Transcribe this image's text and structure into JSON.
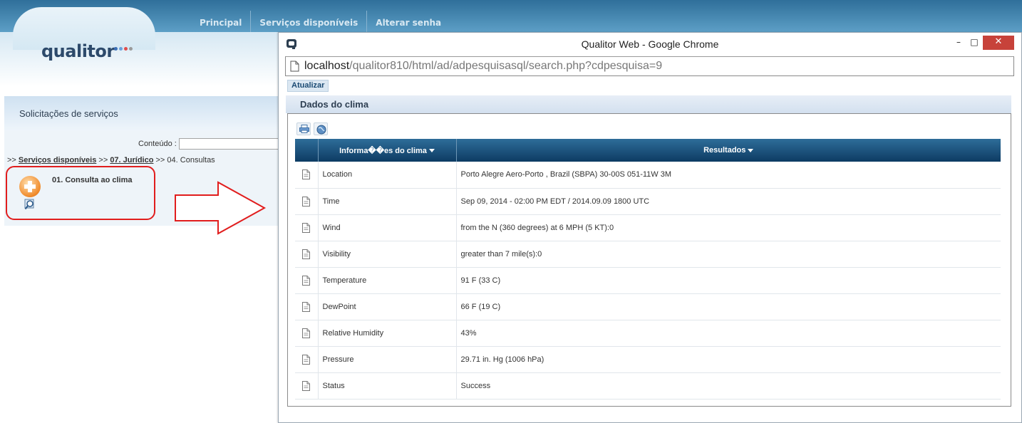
{
  "app": {
    "logo_text": "qualitor",
    "logo_dot_colors": [
      "#3a6fb7",
      "#6aa1dc",
      "#e14b4b",
      "#9a9a9a",
      "#6aa1dc"
    ],
    "nav": [
      "Principal",
      "Serviços disponíveis",
      "Alterar senha"
    ],
    "panel_title": "Solicitações de serviços",
    "search_label": "Conteúdo :",
    "search_value": "",
    "breadcrumb": {
      "prefix": ">> ",
      "link1": "Serviços disponíveis",
      "sep1": " >> ",
      "link2": "07. Jurídico",
      "sep2": " >> ",
      "current": "04. Consultas"
    },
    "service_item_label": "01. Consulta ao clima"
  },
  "popup": {
    "window_title": "Qualitor Web - Google Chrome",
    "controls": {
      "minimize": "–",
      "maximize": "□",
      "close": "✕"
    },
    "url_host": "localhost",
    "url_path": "/qualitor810/html/ad/adpesquisasql/search.php?cdpesquisa=9",
    "refresh_label": "Atualizar",
    "section_title": "Dados do clima",
    "toolbar_icons": [
      "print-icon",
      "globe-icon"
    ],
    "table": {
      "headers": [
        "",
        "Informa��es do clima",
        "Resultados"
      ],
      "rows": [
        {
          "key": "Location",
          "value": "Porto Alegre Aero-Porto , Brazil (SBPA) 30-00S 051-11W 3M"
        },
        {
          "key": "Time",
          "value": "Sep 09, 2014 - 02:00 PM EDT / 2014.09.09 1800 UTC"
        },
        {
          "key": "Wind",
          "value": "from the N (360 degrees) at 6 MPH (5 KT):0"
        },
        {
          "key": "Visibility",
          "value": "greater than 7 mile(s):0"
        },
        {
          "key": "Temperature",
          "value": "91 F (33 C)"
        },
        {
          "key": "DewPoint",
          "value": "66 F (19 C)"
        },
        {
          "key": "Relative Humidity",
          "value": "43%"
        },
        {
          "key": "Pressure",
          "value": "29.71 in. Hg (1006 hPa)"
        },
        {
          "key": "Status",
          "value": "Success"
        }
      ]
    }
  },
  "colors": {
    "nav_bar": "#2f6f9a",
    "table_header": "#0d3b63",
    "highlight_red": "#e11d1d",
    "close_button": "#c7423a"
  }
}
